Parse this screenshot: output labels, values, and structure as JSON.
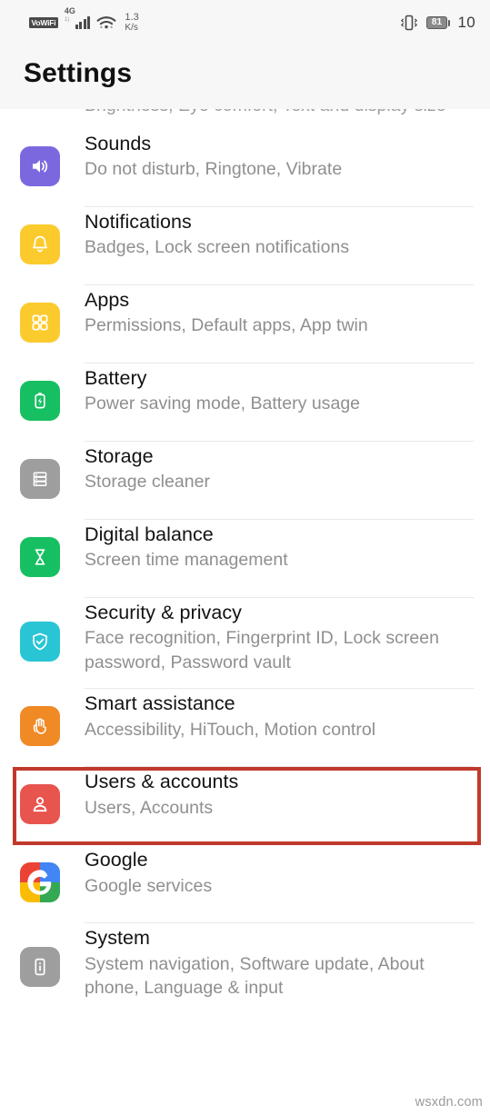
{
  "status_bar": {
    "vowifi_label": "VoWiFi",
    "network_type": "4G",
    "network_sub": "1)",
    "wifi_icon": "wifi-icon",
    "data_speed_value": "1.3",
    "data_speed_unit": "K/s",
    "vibrate_icon": "vibrate-icon",
    "battery_level": "81",
    "clock": "10"
  },
  "header": {
    "title": "Settings"
  },
  "clipped_row": {
    "subtitle": "Brightness, Eye comfort, Text and display size"
  },
  "colors": {
    "sounds_icon": "#7C68DE",
    "notifications_icon": "#FBCB2E",
    "apps_icon": "#FBCB2E",
    "battery_icon": "#17BF63",
    "storage_icon": "#9E9E9E",
    "digital_balance_icon": "#17BF63",
    "security_icon": "#29C5D4",
    "smart_assistance_icon": "#F08A25",
    "users_accounts_icon": "#E8554E",
    "system_icon": "#9E9E9E",
    "highlight_border": "#C0392B",
    "title_text": "#131313",
    "subtitle_text": "#8F8F8F"
  },
  "settings_items": [
    {
      "id": "sounds",
      "title": "Sounds",
      "subtitle": "Do not disturb, Ringtone, Vibrate",
      "icon": "speaker-icon",
      "highlighted": false
    },
    {
      "id": "notifications",
      "title": "Notifications",
      "subtitle": "Badges, Lock screen notifications",
      "icon": "bell-icon",
      "highlighted": false
    },
    {
      "id": "apps",
      "title": "Apps",
      "subtitle": "Permissions, Default apps, App twin",
      "icon": "grid-icon",
      "highlighted": false
    },
    {
      "id": "battery",
      "title": "Battery",
      "subtitle": "Power saving mode, Battery usage",
      "icon": "battery-bolt-icon",
      "highlighted": false
    },
    {
      "id": "storage",
      "title": "Storage",
      "subtitle": "Storage cleaner",
      "icon": "storage-stack-icon",
      "highlighted": false
    },
    {
      "id": "digital-balance",
      "title": "Digital balance",
      "subtitle": "Screen time management",
      "icon": "hourglass-icon",
      "highlighted": false
    },
    {
      "id": "security-privacy",
      "title": "Security & privacy",
      "subtitle": "Face recognition, Fingerprint ID, Lock screen password, Password vault",
      "icon": "shield-check-icon",
      "highlighted": false
    },
    {
      "id": "smart-assistance",
      "title": "Smart assistance",
      "subtitle": "Accessibility, HiTouch, Motion control",
      "icon": "hand-icon",
      "highlighted": false
    },
    {
      "id": "users-accounts",
      "title": "Users & accounts",
      "subtitle": "Users, Accounts",
      "icon": "person-icon",
      "highlighted": true
    },
    {
      "id": "google",
      "title": "Google",
      "subtitle": "Google services",
      "icon": "google-g-icon",
      "highlighted": false
    },
    {
      "id": "system",
      "title": "System",
      "subtitle": "System navigation, Software update, About phone, Language & input",
      "icon": "phone-info-icon",
      "highlighted": false
    }
  ],
  "watermark": "wsxdn.com"
}
